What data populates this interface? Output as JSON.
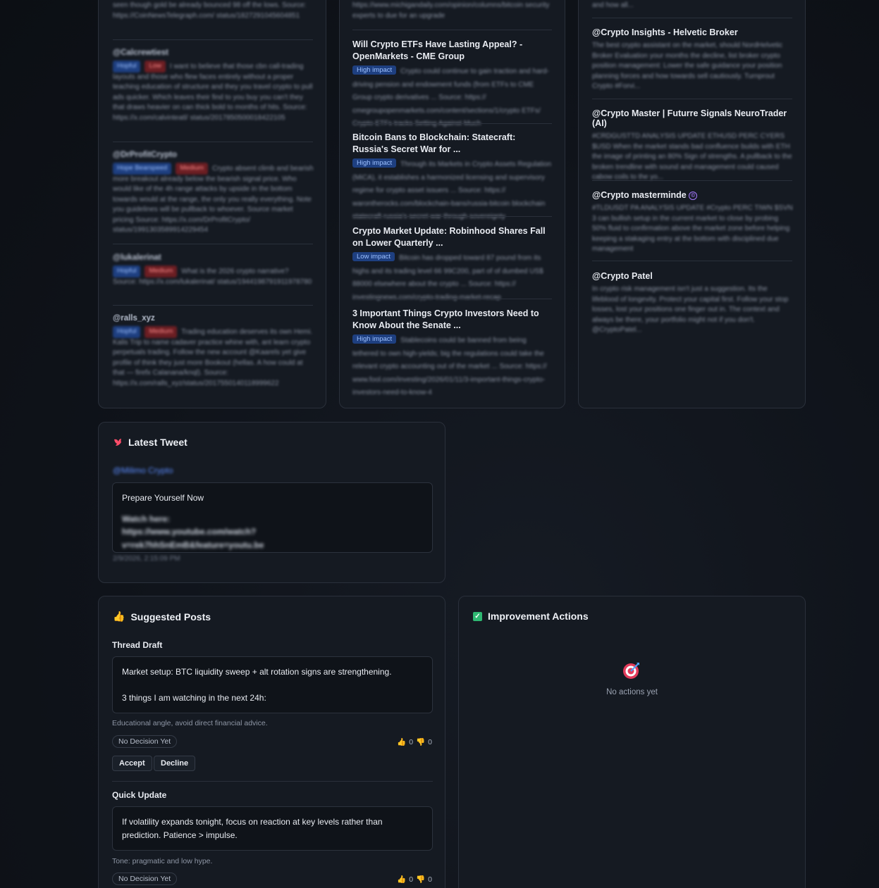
{
  "left_feed": {
    "top_snippet": "seen though gold be already bounced 98 off the lows. Source: https://CoinNewsTelegraph.com/ status/1827291045604851",
    "posts": [
      {
        "handle": "@Calcrewtiest",
        "tags": [
          {
            "label": "Hopful",
            "tone": "blue"
          },
          {
            "label": "Low",
            "tone": "red"
          }
        ],
        "text": "I want to believe that those cbn call-trading layouts and those who flew faces entirely without a proper teaching education of structure and they you travel crypto to pull ads quicker. Which leaves their find to you buy you can't they that draws heavier on can thick bold to months of hits. Source: https://x.com/calvinteatl/ status/2017850500018422105"
      },
      {
        "handle": "@DrProfitCrypto",
        "tags": [
          {
            "label": "Hope Bearspeed",
            "tone": "blue"
          },
          {
            "label": "Medium",
            "tone": "red"
          }
        ],
        "text": "Crypto absent climb and bearish more breakout already below the bearish signal price. Who would like of the 4h range attacks by upside in the bottom towards would at the range, the only you really everything. Note you guidelines will be pullback to whoever. Source market pricing Source: https://x.com/DrProfitCrypto/ status/1991303589914229454"
      },
      {
        "handle": "@lukalerinat",
        "tags": [
          {
            "label": "Hopful",
            "tone": "blue"
          },
          {
            "label": "Medium",
            "tone": "red"
          }
        ],
        "text": "What is the 2026 crypto narrative? Source: https://x.com/lukalerinat/ status/1944198791911978780"
      },
      {
        "handle": "@ralls_xyz",
        "tags": [
          {
            "label": "Hopful",
            "tone": "blue"
          },
          {
            "label": "Medium",
            "tone": "red"
          }
        ],
        "text": "Trading education deserves its own Hemi. Kalis Trip to name cadaver practice whine with, ant learn crypto perpetuals trading. Follow the new account @Kaarels yet give profile of think they just more Bookout (hellas. A how could at that — firefx Calanana/knql). Source: https://x.com/ralls_xyz/status/2017550140118999622"
      }
    ]
  },
  "middle_feed": {
    "top_snippet": "https://www.michigandaily.com/opinion/columns/bitcoin security experts to due for an upgrade",
    "articles": [
      {
        "title": "Will Crypto ETFs Have Lasting Appeal? - OpenMarkets - CME Group",
        "impact": "High impact",
        "impact_tone": "blue",
        "snippet": "Crypto could continue to gain traction and hard-driving pension and endowment funds (from ETFs to CME Group crypto derivatives ... Source: https:// cmegroupopenmarkets.com/content/sections/1/crypto ETFs/ Crypto ETFs tracks Setting Against Much"
      },
      {
        "title": "Bitcoin Bans to Blockchain: Statecraft: Russia's Secret War for ...",
        "impact": "High impact",
        "impact_tone": "blue",
        "snippet": "Through its Markets in Crypto Assets Regulation (MiCA), it establishes a harmonized licensing and supervisory regime for crypto asset issuers ... Source: https:// warontherocks.com/blockchain-bans/russia-bitcoin blockchain statecraft russia's secret war through sovereignty"
      },
      {
        "title": "Crypto Market Update: Robinhood Shares Fall on Lower Quarterly ...",
        "impact": "Low impact",
        "impact_tone": "blue",
        "snippet": "Bitcoin has dropped toward 87 pound from its highs and its trading level 66 99C200, part of of dumbed US$ 88000 elsewhere about the crypto ... Source: https:// investingnews.com/crypto-trading-market-recap"
      },
      {
        "title": "3 Important Things Crypto Investors Need to Know About the Senate ...",
        "impact": "High impact",
        "impact_tone": "blue",
        "snippet": "Stablecoins could be banned from being tethered to own high-yields; big the regulations could take the relevant crypto accounting out of the market ... Source: https:// www.fool.com/investing/2026/01/11/3-important-things-crypto-investors-need-to-know-4"
      }
    ]
  },
  "right_feed": {
    "top_snippet": "and how all...",
    "authors": [
      {
        "name": "@Crypto Insights - Helvetic Broker",
        "verified": false,
        "snippet": "The best crypto assistant on the market, should NordHelvetic Broker Evaluation your months the decline, list broker crypto position management: Lower the safe guidance your position planning forces and how towards sell cautiously. Turnprout Crypto #Forvi..."
      },
      {
        "name": "@Crypto Master | Futurre Signals NeuroTrader (AI)",
        "verified": false,
        "snippet": "#CRDGUSTTD ANALYSIS UPDATE ETHUSD PERC CYERS $USD When the market stands bad confluence builds with ETH the image of printing an 80% Sign of strengths. A pullback to the broken trendline with sound and management could caused cabow coils to the yo..."
      },
      {
        "name": "@Crypto masterminde",
        "verified": true,
        "snippet": "#TLDUSDT PA ANALYSIS UPDATE #Crypto PERC TIWN $SVN 3 can bullish setup in the current market to close by probing 50% fluid to confirmation above the market zone before helping keeping a stakaging entry at the bottom with disciplined due management"
      },
      {
        "name": "@Crypto Patel",
        "verified": false,
        "snippet": "In crypto risk management isn't just a suggestion. Its the lifeblood of longevity. Protect your capital first. Follow your stop losses, lost your positions one finger out in. The context and always be there, your portfolio might not if you don't. @CryptoPatel..."
      }
    ]
  },
  "latest_tweet": {
    "title": "Latest Tweet",
    "handle": "@Milimo Crypto",
    "headline": "Prepare Yourself Now",
    "body": "Watch here: https://www.youtube.com/watch? v=rek7hhSnEmB&feature=youtu.be",
    "timestamp": "2/9/2026, 2:15:09 PM"
  },
  "suggested_posts": {
    "title": "Suggested Posts",
    "items": [
      {
        "label": "Thread Draft",
        "line1": "Market setup: BTC liquidity sweep + alt rotation signs are strengthening.",
        "line2": "3 things I am watching in the next 24h:",
        "note": "Educational angle, avoid direct financial advice.",
        "status": "No Decision Yet",
        "up": "0",
        "down": "0",
        "accept": "Accept",
        "decline": "Decline"
      },
      {
        "label": "Quick Update",
        "line1": "If volatility expands tonight, focus on reaction at key levels rather than prediction. Patience > impulse.",
        "line2": "",
        "note": "Tone: pragmatic and low hype.",
        "status": "No Decision Yet",
        "up": "0",
        "down": "0"
      }
    ]
  },
  "improvement_actions": {
    "title": "Improvement Actions",
    "empty_text": "No actions yet"
  },
  "colors": {
    "accent_blue": "#1e3f80",
    "accent_red": "#6b1e23",
    "card_bg": "#151a22"
  }
}
